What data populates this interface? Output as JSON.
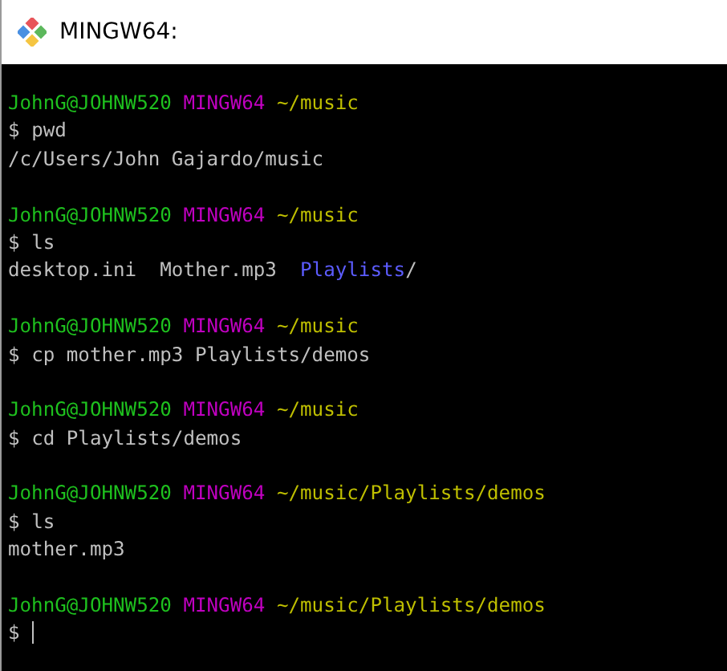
{
  "window": {
    "title": "MINGW64:"
  },
  "terminal": {
    "lines": [
      {
        "kind": "prompt",
        "user": "JohnG@JOHNW520",
        "system": "MINGW64",
        "path": "~/music"
      },
      {
        "kind": "command",
        "symbol": "$",
        "text": "pwd"
      },
      {
        "kind": "output",
        "segments": [
          {
            "text": "/c/Users/John Gajardo/music",
            "color": "#c0c0c0"
          }
        ]
      },
      {
        "kind": "blank"
      },
      {
        "kind": "prompt",
        "user": "JohnG@JOHNW520",
        "system": "MINGW64",
        "path": "~/music"
      },
      {
        "kind": "command",
        "symbol": "$",
        "text": "ls"
      },
      {
        "kind": "output",
        "segments": [
          {
            "text": "desktop.ini",
            "color": "#c0c0c0"
          },
          {
            "text": "Mother.mp3",
            "color": "#c0c0c0"
          },
          {
            "text": "Playlists",
            "color": "#5c5cff"
          },
          {
            "text": "/",
            "color": "#c0c0c0"
          }
        ]
      },
      {
        "kind": "blank"
      },
      {
        "kind": "prompt",
        "user": "JohnG@JOHNW520",
        "system": "MINGW64",
        "path": "~/music"
      },
      {
        "kind": "command",
        "symbol": "$",
        "text": "cp mother.mp3 Playlists/demos"
      },
      {
        "kind": "blank"
      },
      {
        "kind": "prompt",
        "user": "JohnG@JOHNW520",
        "system": "MINGW64",
        "path": "~/music"
      },
      {
        "kind": "command",
        "symbol": "$",
        "text": "cd Playlists/demos"
      },
      {
        "kind": "blank"
      },
      {
        "kind": "prompt",
        "user": "JohnG@JOHNW520",
        "system": "MINGW64",
        "path": "~/music/Playlists/demos"
      },
      {
        "kind": "command",
        "symbol": "$",
        "text": "ls"
      },
      {
        "kind": "output",
        "segments": [
          {
            "text": "mother.mp3",
            "color": "#c0c0c0"
          }
        ]
      },
      {
        "kind": "blank"
      },
      {
        "kind": "prompt",
        "user": "JohnG@JOHNW520",
        "system": "MINGW64",
        "path": "~/music/Playlists/demos"
      },
      {
        "kind": "input",
        "symbol": "$"
      }
    ]
  }
}
